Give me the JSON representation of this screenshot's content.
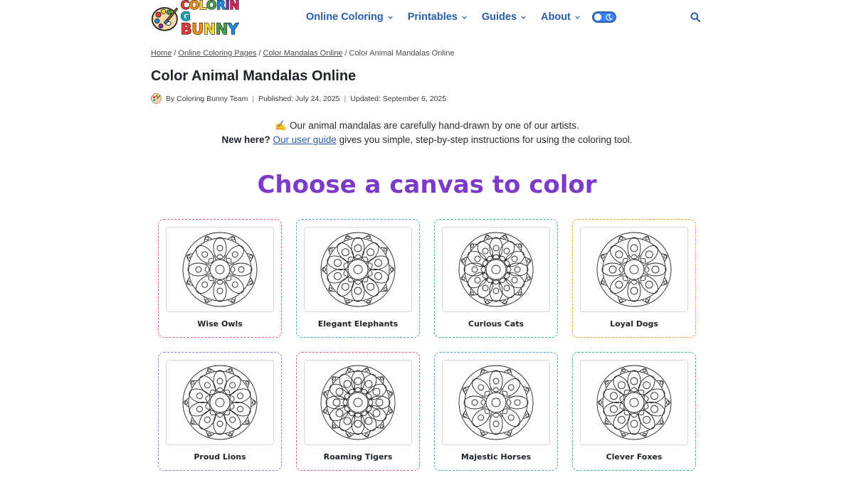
{
  "header": {
    "logo": {
      "line1": "COLORING",
      "line2": "BUNNY"
    },
    "nav": [
      {
        "label": "Online Coloring"
      },
      {
        "label": "Printables"
      },
      {
        "label": "Guides"
      },
      {
        "label": "About"
      }
    ],
    "icons": {
      "search": "search-icon",
      "theme_toggle": "dark-mode-toggle"
    }
  },
  "breadcrumb": {
    "items": [
      "Home",
      "Online Coloring Pages",
      "Color Mandalas Online"
    ],
    "current": "Color Animal Mandalas Online",
    "separator": "/"
  },
  "page": {
    "title": "Color Animal Mandalas Online",
    "meta": {
      "author": "By Coloring Bunny Team",
      "published": "Published: July 24, 2025",
      "updated": "Updated: September 6, 2025"
    },
    "intro": {
      "emoji": "✍️",
      "line1": "Our animal mandalas are carefully hand-drawn by one of our artists.",
      "new_here": "New here?",
      "guide_link": "Our user guide",
      "line2_rest": "gives you simple, step-by-step instructions for using the coloring tool."
    },
    "section_title": "Choose a canvas to color"
  },
  "cards": [
    {
      "label": "Wise Owls",
      "border_color": "#e8508f"
    },
    {
      "label": "Elegant Elephants",
      "border_color": "#3aa3d8"
    },
    {
      "label": "Curious Cats",
      "border_color": "#2eb87a"
    },
    {
      "label": "Loyal Dogs",
      "border_color": "#f0a020"
    },
    {
      "label": "Proud Lions",
      "border_color": "#9b6fe0"
    },
    {
      "label": "Roaming Tigers",
      "border_color": "#e8508f"
    },
    {
      "label": "Majestic Horses",
      "border_color": "#3aa3d8"
    },
    {
      "label": "Clever Foxes",
      "border_color": "#2eb87a"
    }
  ],
  "colors": {
    "nav": "#2a5ea6",
    "heading_accent": "#7c3ac8",
    "logo_letters": [
      "#e53935",
      "#fb8c00",
      "#fdd835",
      "#43a047",
      "#1e88e5",
      "#8e24aa",
      "#e91e63",
      "#00acc1"
    ]
  }
}
